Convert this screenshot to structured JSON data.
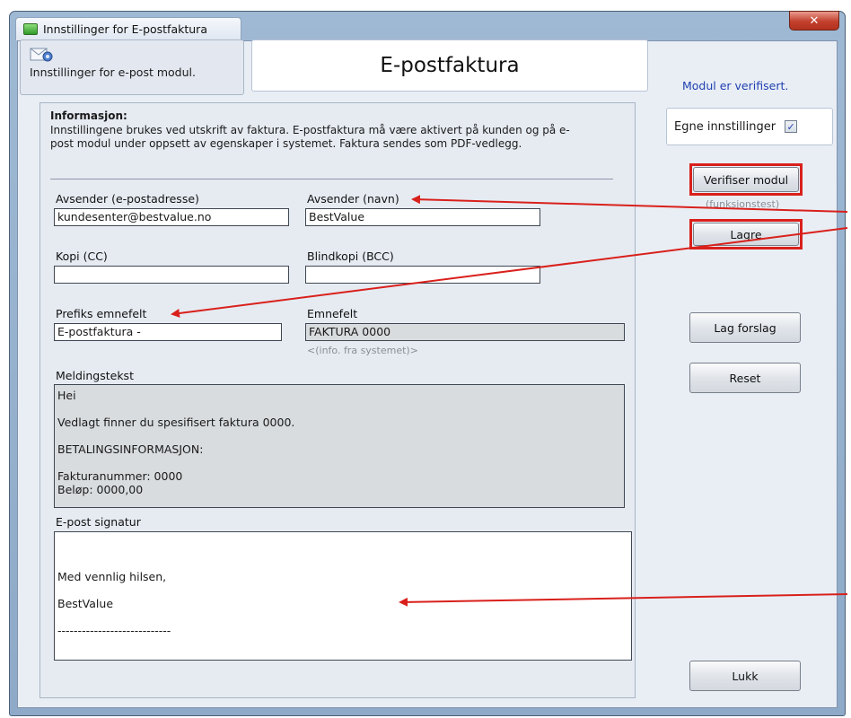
{
  "window": {
    "title": "Innstillinger for E-postfaktura",
    "close_glyph": "✕"
  },
  "header": {
    "module_tab_label": "Innstillinger for e-post modul.",
    "page_title": "E-postfaktura"
  },
  "status": {
    "verified_text": "Modul er verifisert."
  },
  "own_settings": {
    "label": "Egne innstillinger",
    "checked": true,
    "check_glyph": "✓"
  },
  "info": {
    "title": "Informasjon:",
    "text": "Innstillingene brukes ved utskrift av faktura. E-postfaktura må være aktivert på kunden og på e-post modul under oppsett av egenskaper i systemet. Faktura sendes som PDF-vedlegg."
  },
  "fields": {
    "sender_email": {
      "label": "Avsender (e-postadresse)",
      "value": "kundesenter@bestvalue.no"
    },
    "sender_name": {
      "label": "Avsender (navn)",
      "value": "BestValue"
    },
    "cc": {
      "label": "Kopi (CC)",
      "value": ""
    },
    "bcc": {
      "label": "Blindkopi (BCC)",
      "value": ""
    },
    "subject_prefix": {
      "label": "Prefiks emnefelt",
      "value": "E-postfaktura -"
    },
    "subject": {
      "label": "Emnefelt",
      "value": "FAKTURA 0000",
      "hint": "<(info. fra systemet)>"
    }
  },
  "message": {
    "label": "Meldingstekst",
    "lines": [
      "Hei",
      "Vedlagt finner du spesifisert faktura 0000.",
      "BETALINGSINFORMASJON:",
      "Fakturanummer: 0000",
      "Beløp: 0000,00"
    ]
  },
  "signature": {
    "label": "E-post signatur",
    "lines": [
      "Med vennlig hilsen,",
      "BestValue",
      "----------------------------"
    ]
  },
  "buttons": {
    "verify": "Verifiser modul",
    "verify_hint": "(funksjonstest)",
    "save": "Lagre",
    "suggest": "Lag forslag",
    "reset": "Reset",
    "close": "Lukk"
  },
  "colors": {
    "annotation_red": "#d9201b",
    "verified_blue": "#1f3fb0"
  }
}
